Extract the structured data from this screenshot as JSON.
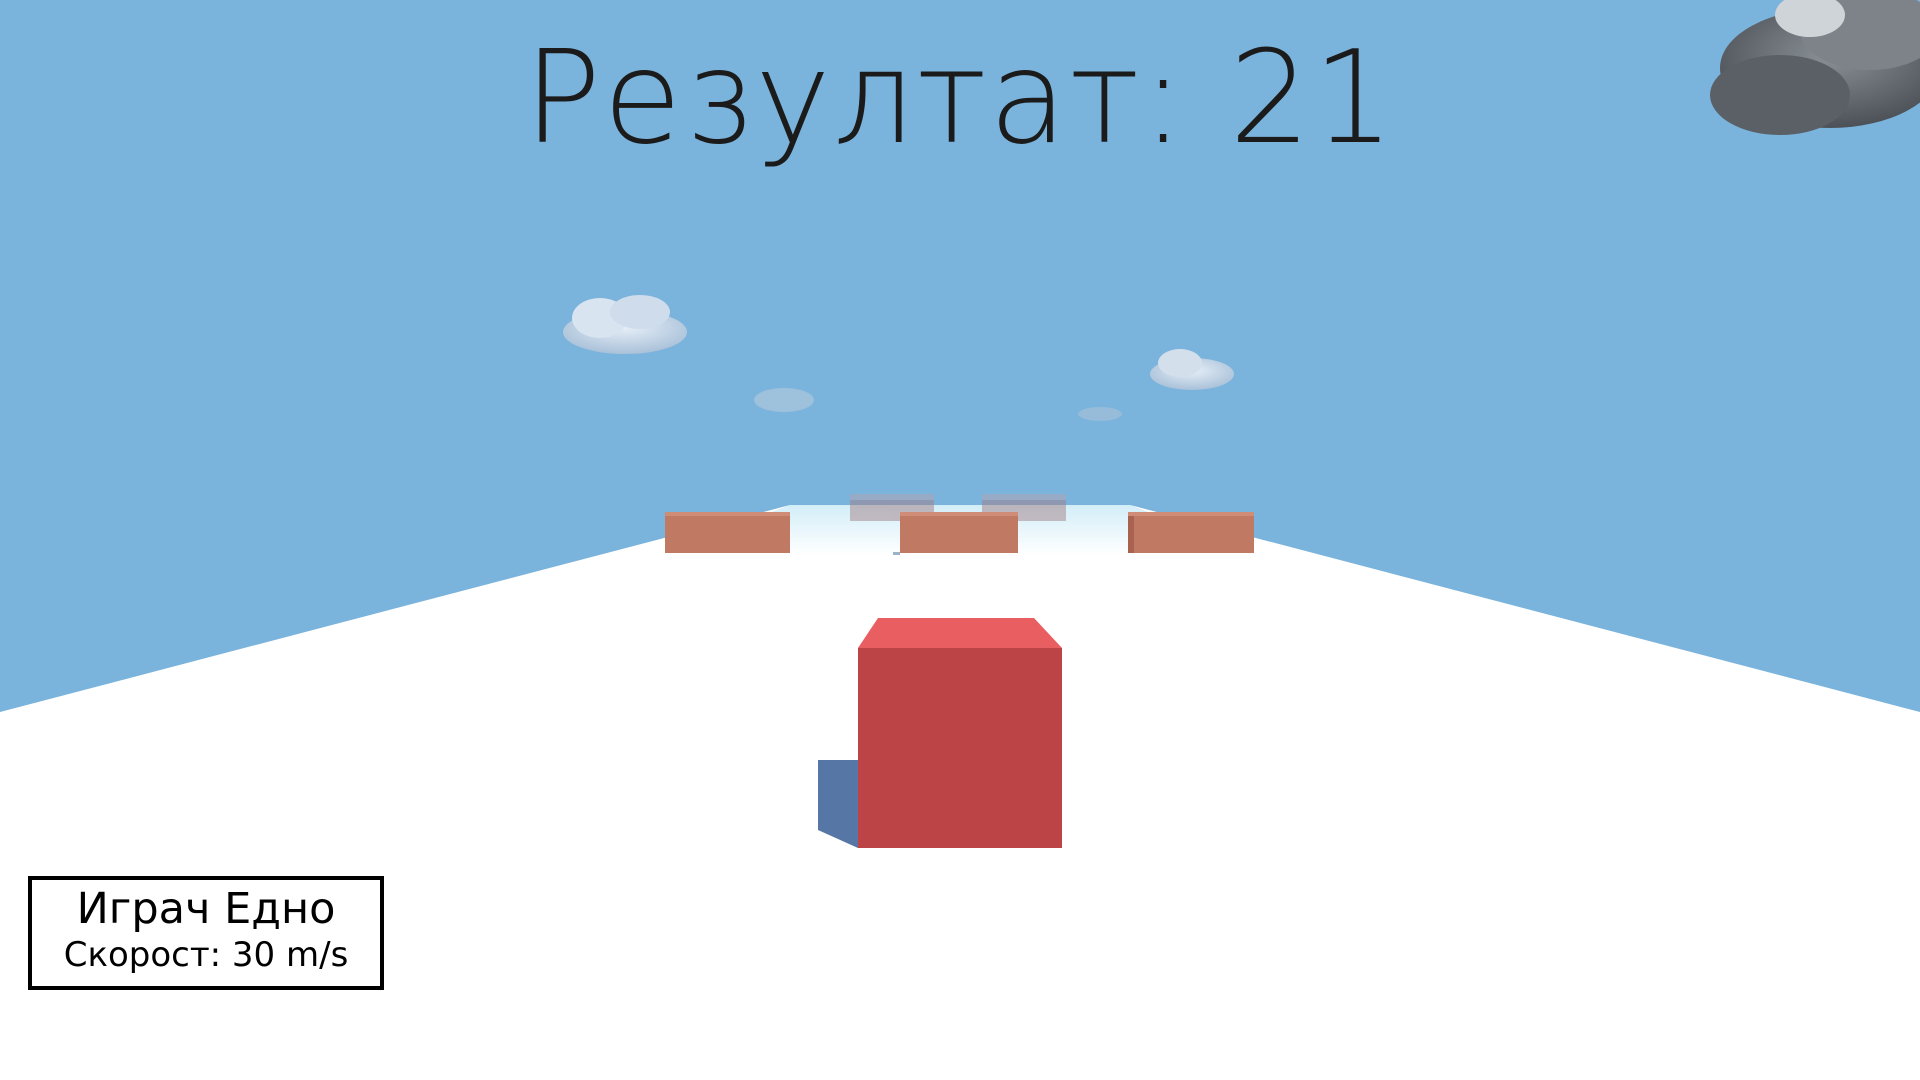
{
  "hud": {
    "score_text": "Резултат: 21",
    "player_label": "Играч Едно",
    "speed_text": "Скорост: 30 m/s"
  },
  "colors": {
    "sky": "#7ab3dc",
    "ground": "#ffffff",
    "player_cube": "#bc4446",
    "obstacle": "#c07963"
  },
  "icons": [
    "cloud-icon"
  ]
}
